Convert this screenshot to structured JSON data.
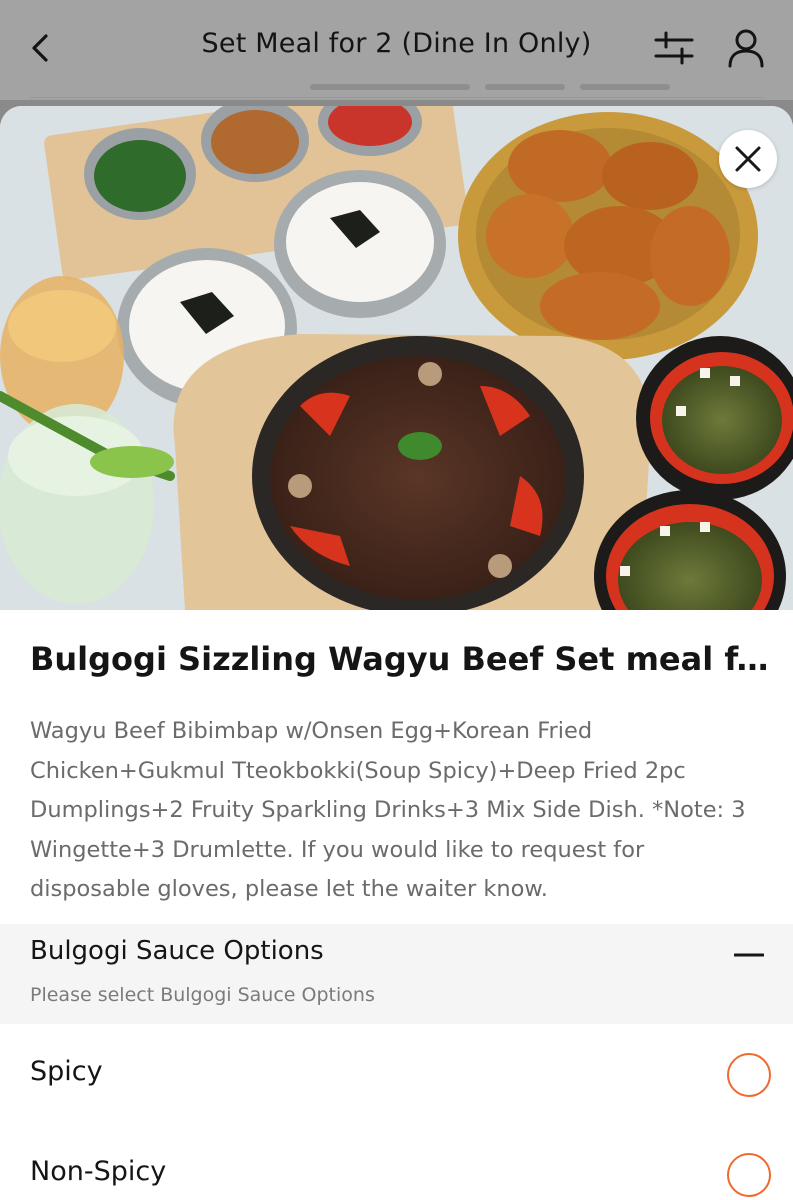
{
  "header": {
    "title": "Set Meal for 2 (Dine In Only)",
    "back_icon": "chevron-left-icon",
    "filter_icon": "sliders-icon",
    "profile_icon": "user-icon"
  },
  "item": {
    "image_alt": "Set meal photo",
    "close_icon": "close-icon",
    "title": "Bulgogi Sizzling Wagyu Beef Set meal f...",
    "description": "Wagyu Beef Bibimbap w/Onsen Egg+Korean Fried Chicken+Gukmul Tteokbokki(Soup Spicy)+Deep Fried 2pc Dumplings+2 Fruity Sparkling Drinks+3 Mix Side Dish. *Note: 3 Wingette+3 Drumlette. If you would like to request for disposable gloves, please let the waiter know."
  },
  "options_section": {
    "heading": "Bulgogi Sauce Options",
    "subtext": "Please select Bulgogi Sauce Options",
    "collapse_icon": "minus-icon",
    "options": [
      {
        "label": "Spicy",
        "selected": false
      },
      {
        "label": "Non-Spicy",
        "selected": false
      }
    ]
  },
  "colors": {
    "accent": "#ee6a2f",
    "text_primary": "#151515",
    "text_secondary": "#6b6b6b",
    "section_bg": "#f5f5f5"
  }
}
